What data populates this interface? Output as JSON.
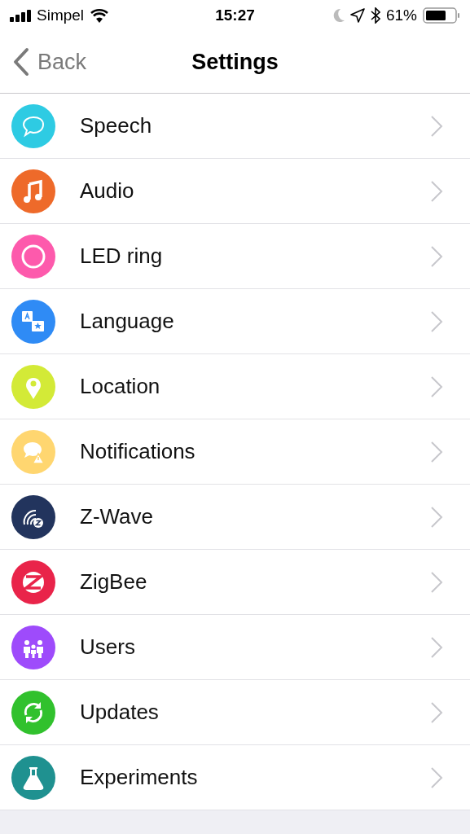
{
  "status_bar": {
    "carrier": "Simpel",
    "time": "15:27",
    "battery": "61%"
  },
  "nav": {
    "back": "Back",
    "title": "Settings"
  },
  "items": [
    {
      "label": "Speech",
      "kind": "speech",
      "color": "#2ecbe3"
    },
    {
      "label": "Audio",
      "kind": "audio",
      "color": "#ee6a2a"
    },
    {
      "label": "LED ring",
      "kind": "ring",
      "color": "#fd5aac"
    },
    {
      "label": "Language",
      "kind": "language",
      "color": "#2f8bf5"
    },
    {
      "label": "Location",
      "kind": "location",
      "color": "#d3ea37"
    },
    {
      "label": "Notifications",
      "kind": "notifications",
      "color": "#ffd670"
    },
    {
      "label": "Z-Wave",
      "kind": "zwave",
      "color": "#22345d"
    },
    {
      "label": "ZigBee",
      "kind": "zigbee",
      "color": "#e9244a"
    },
    {
      "label": "Users",
      "kind": "users",
      "color": "#9e4bfb"
    },
    {
      "label": "Updates",
      "kind": "updates",
      "color": "#31c12d"
    },
    {
      "label": "Experiments",
      "kind": "experiments",
      "color": "#1f9190"
    }
  ]
}
